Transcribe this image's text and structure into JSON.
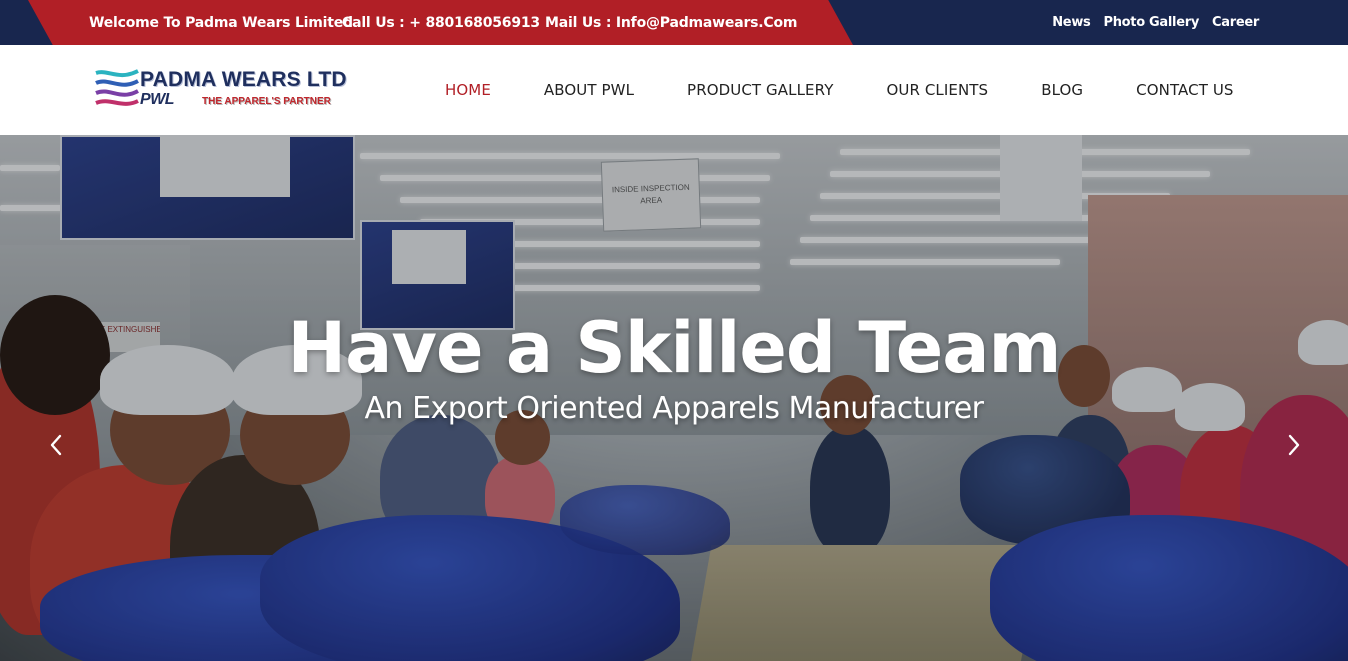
{
  "topbar": {
    "welcome": "Welcome To Padma Wears Limited",
    "call": "Call Us : + 880168056913",
    "mail": "Mail Us : Info@Padmawears.Com",
    "links": [
      "News",
      "Photo Gallery",
      "Career"
    ]
  },
  "logo": {
    "name": "PADMA WEARS LTD",
    "short": "PWL",
    "tagline": "THE APPAREL'S PARTNER"
  },
  "nav": {
    "items": [
      "HOME",
      "ABOUT PWL",
      "PRODUCT GALLERY",
      "OUR CLIENTS",
      "BLOG",
      "CONTACT US"
    ],
    "active": "HOME"
  },
  "hero": {
    "title": "Have a Skilled Team",
    "subtitle": "An Export Oriented Apparels Manufacturer",
    "sign_text": "INSIDE INSPECTION AREA",
    "wall_sign": "FIRE EXTINGUISHE",
    "prev_icon": "chevron-left-icon",
    "next_icon": "chevron-right-icon"
  },
  "colors": {
    "topbar_navy": "#18264e",
    "topbar_red": "#b11f26",
    "nav_active": "#b11f26",
    "logo_navy": "#1f2f5e"
  }
}
